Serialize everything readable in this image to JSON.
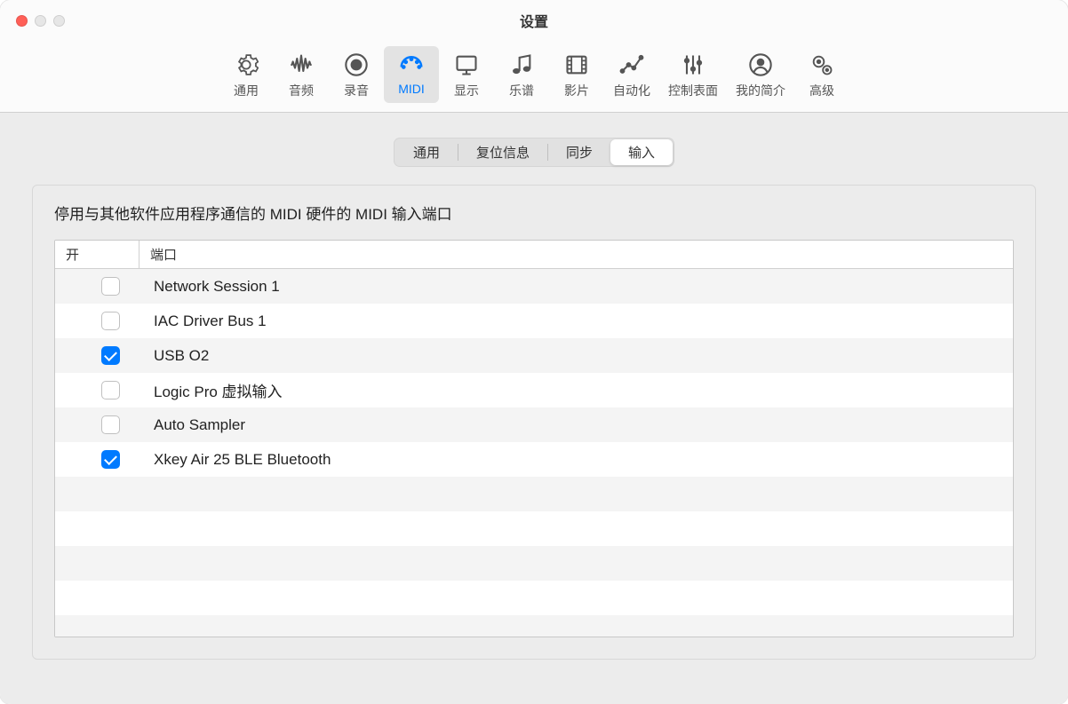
{
  "window": {
    "title": "设置"
  },
  "toolbar": {
    "items": [
      {
        "label": "通用",
        "icon": "gear"
      },
      {
        "label": "音频",
        "icon": "waveform"
      },
      {
        "label": "录音",
        "icon": "record"
      },
      {
        "label": "MIDI",
        "icon": "midi",
        "active": true
      },
      {
        "label": "显示",
        "icon": "display"
      },
      {
        "label": "乐谱",
        "icon": "score"
      },
      {
        "label": "影片",
        "icon": "film"
      },
      {
        "label": "自动化",
        "icon": "automation"
      },
      {
        "label": "控制表面",
        "icon": "sliders"
      },
      {
        "label": "我的简介",
        "icon": "profile"
      },
      {
        "label": "高级",
        "icon": "advanced"
      }
    ]
  },
  "tabs": {
    "items": [
      {
        "label": "通用"
      },
      {
        "label": "复位信息"
      },
      {
        "label": "同步"
      },
      {
        "label": "输入",
        "active": true
      }
    ]
  },
  "panel": {
    "description": "停用与其他软件应用程序通信的 MIDI 硬件的 MIDI 输入端口",
    "columns": {
      "on": "开",
      "port": "端口"
    },
    "rows": [
      {
        "checked": false,
        "port": "Network Session 1"
      },
      {
        "checked": false,
        "port": "IAC Driver Bus 1"
      },
      {
        "checked": true,
        "port": "USB O2"
      },
      {
        "checked": false,
        "port": "Logic Pro 虚拟输入"
      },
      {
        "checked": false,
        "port": "Auto Sampler"
      },
      {
        "checked": true,
        "port": "Xkey Air 25 BLE Bluetooth"
      }
    ]
  }
}
